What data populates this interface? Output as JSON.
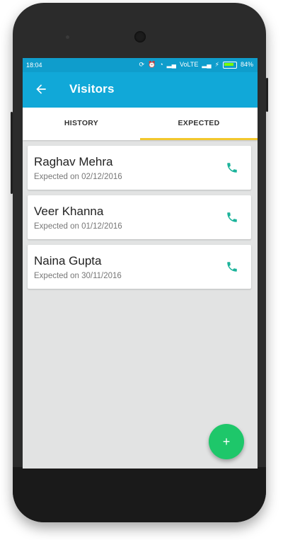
{
  "status_bar": {
    "time": "18:04",
    "network": "VoLTE",
    "battery": "84%"
  },
  "app_bar": {
    "title": "Visitors"
  },
  "tabs": [
    {
      "label": "HISTORY",
      "active": false
    },
    {
      "label": "EXPECTED",
      "active": true
    }
  ],
  "visitors": [
    {
      "name": "Raghav Mehra",
      "expected": "Expected on 02/12/2016"
    },
    {
      "name": "Veer Khanna",
      "expected": "Expected on 01/12/2016"
    },
    {
      "name": "Naina Gupta",
      "expected": "Expected on 30/11/2016"
    }
  ],
  "fab": {
    "icon": "+"
  },
  "colors": {
    "status_bar": "#0f9dcc",
    "app_bar": "#11a8d8",
    "tab_indicator": "#f2c82e",
    "call_icon": "#1bb39a",
    "fab": "#1ec76a"
  }
}
